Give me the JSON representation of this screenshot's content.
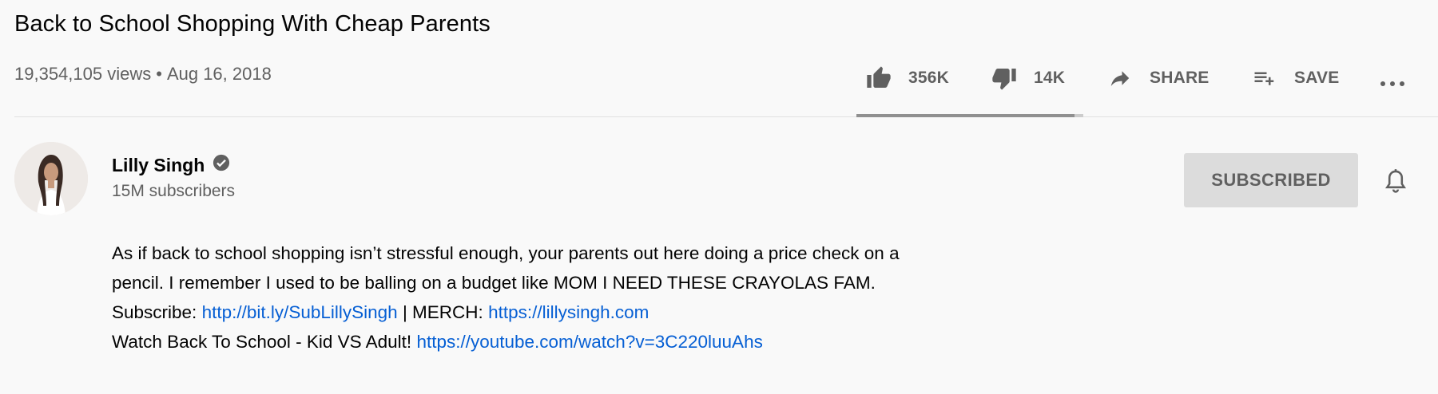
{
  "video": {
    "title": "Back to School Shopping With Cheap Parents",
    "views": "19,354,105 views",
    "separator": "•",
    "date": "Aug 16, 2018"
  },
  "actions": {
    "like_count": "356K",
    "dislike_count": "14K",
    "share_label": "SHARE",
    "save_label": "SAVE",
    "like_ratio": 0.96
  },
  "channel": {
    "name": "Lilly Singh",
    "subscribers": "15M subscribers",
    "subscribe_label": "SUBSCRIBED"
  },
  "description": {
    "line1": "As if back to school shopping isn’t stressful enough, your parents out here doing a price check on a",
    "line2": "pencil. I remember I used to be balling on a budget like MOM I NEED THESE CRAYOLAS FAM.",
    "subscribe_prefix": "Subscribe: ",
    "subscribe_link": "http://bit.ly/SubLillySingh",
    "merch_prefix": " | MERCH: ",
    "merch_link": "https://lillysingh.com",
    "watch_prefix": "Watch Back To School - Kid VS Adult! ",
    "watch_link": "https://youtube.com/watch?v=3C220luuAhs"
  },
  "colors": {
    "link": "#065fd4",
    "secondary_text": "#606060",
    "subscribed_bg": "#dcdcdc"
  },
  "icons": [
    "thumb-up-icon",
    "thumb-down-icon",
    "share-arrow-icon",
    "playlist-add-icon",
    "more-icon",
    "verified-icon",
    "bell-icon"
  ]
}
